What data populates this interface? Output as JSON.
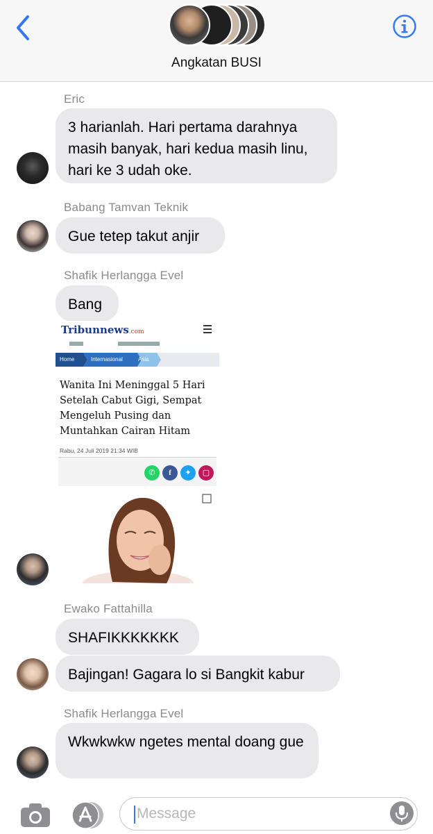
{
  "header": {
    "title": "Angkatan BUSI",
    "back_icon": "chevron-left-icon",
    "info_icon": "info-icon",
    "accent_color": "#3478f6"
  },
  "messages": [
    {
      "sender": "Eric",
      "text": "3 harianlah. Hari pertama darahnya masih banyak, hari kedua masih linu, hari ke 3 udah oke."
    },
    {
      "sender": "Babang Tamvan Teknik",
      "text": "Gue tetep takut anjir"
    },
    {
      "sender": "Shafik Herlangga Evel",
      "text": "Bang"
    },
    {
      "sender": "Ewako Fattahilla",
      "text": "SHAFIKKKKKKK"
    },
    {
      "text": "Bajingan! Gagara lo si Bangkit kabur"
    },
    {
      "sender": "Shafik Herlangga Evel",
      "text": "Wkwkwkw ngetes mental doang gue"
    }
  ],
  "article": {
    "site": "Tribunnews",
    "site_domain": ".com",
    "breadcrumbs": [
      "Home",
      "Internasional",
      "Asia"
    ],
    "headline": "Wanita Ini Meninggal 5 Hari Setelah Cabut Gigi, Sempat Mengeluh Pusing dan Muntahkan Cairan Hitam",
    "date": "Rabu, 24 Juli 2019 21:34 WIB"
  },
  "input": {
    "placeholder": "Message",
    "camera_icon": "camera-icon",
    "apps_icon": "app-store-icon",
    "mic_icon": "microphone-icon"
  }
}
